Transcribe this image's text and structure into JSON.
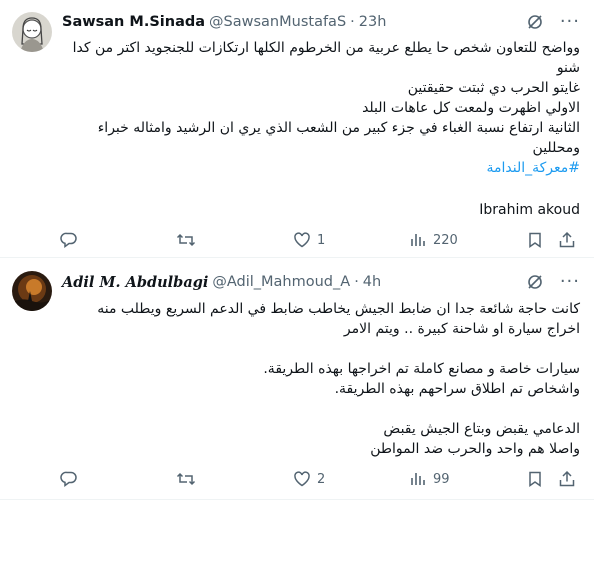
{
  "tweets": [
    {
      "name": "Sawsan M.Sinada",
      "handle": "@SawsanMustafaS",
      "separator": "·",
      "time": "23h",
      "lines": [
        "وواضح للتعاون شخص حا يطلع عربية من الخرطوم الكلها ارتكازات للجنجويد اكتر من كدا",
        "شنو",
        "غايتو الحرب دي ثبتت حقيقتين",
        "الاولي اظهرت ولمعت كل عاهات البلد",
        "الثانية ارتفاع نسبة الغباء في جزء كبير من الشعب الذي يري  ان الرشيد وامثاله خبراء",
        "ومحللين"
      ],
      "hashtag": "#معركة_الندامة",
      "signature": "Ibrahim akoud",
      "replies": "",
      "retweets": "",
      "likes": "1",
      "views": "220"
    },
    {
      "name": "Adil M. Abdulbagi",
      "handle": "@Adil_Mahmoud_A",
      "separator": "·",
      "time": "4h",
      "lines": [
        "كانت حاجة شائعة جدا ان ضابط الجيش يخاطب ضابط في الدعم السريع ويطلب منه",
        "اخراج سيارة او شاحنة كبيرة .. ويتم الامر",
        "",
        "سيارات خاصة و مصانع كاملة تم اخراجها بهذه الطريقة.",
        "واشخاص تم اطلاق سراحهم بهذه الطريقة.",
        "",
        "الدعامي يقبض وبتاع الجيش يقبض",
        "واصلا هم واحد والحرب ضد المواطن"
      ],
      "replies": "",
      "retweets": "",
      "likes": "2",
      "views": "99"
    }
  ],
  "icons": {
    "grok": "grok-icon",
    "more": "more-icon",
    "reply": "reply-icon",
    "retweet": "retweet-icon",
    "like": "like-icon",
    "views": "views-icon",
    "bookmark": "bookmark-icon",
    "share": "share-icon"
  },
  "more_glyph": "···",
  "colors": {
    "text": "#0f1419",
    "secondary": "#536471",
    "link": "#1d9bf0",
    "divider": "#eff3f4"
  }
}
